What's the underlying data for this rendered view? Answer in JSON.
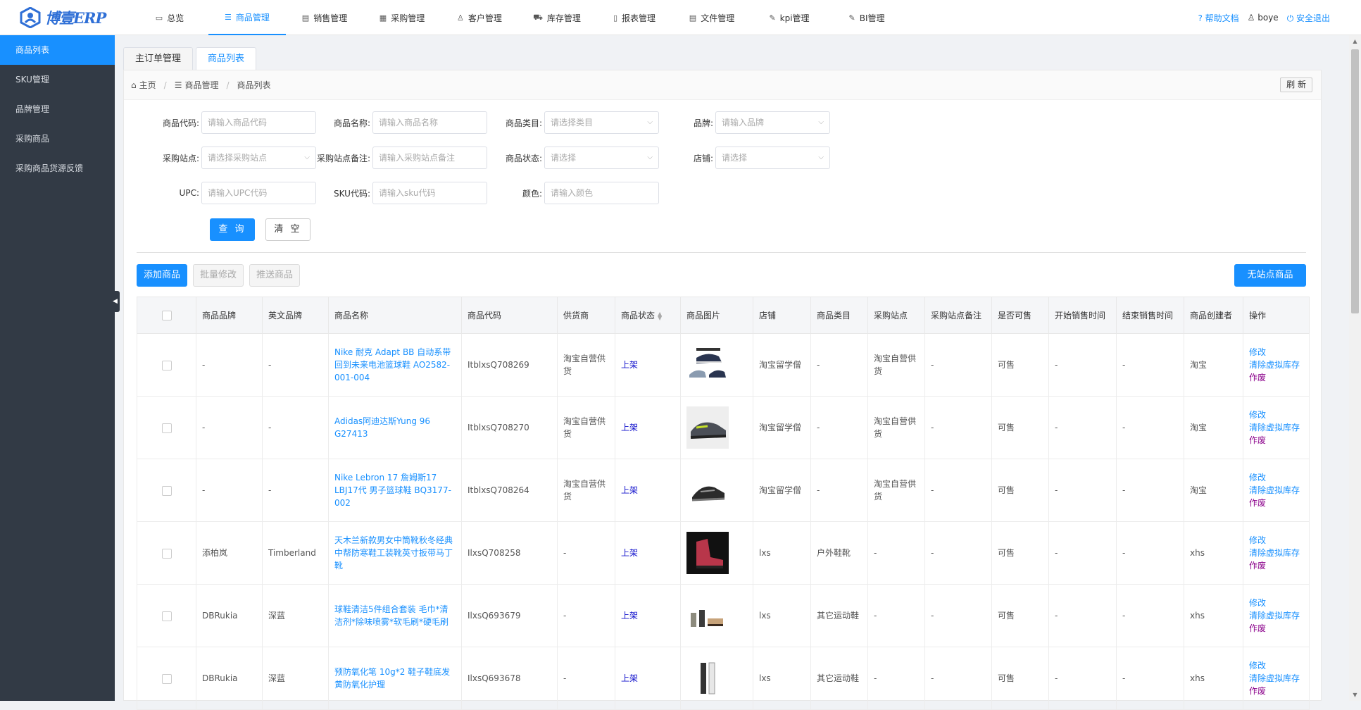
{
  "app": {
    "logo_text": "博壹ERP"
  },
  "topnav": [
    {
      "icon": "monitor-icon",
      "glyph": "▭",
      "label": "总览",
      "active": false
    },
    {
      "icon": "list-icon",
      "glyph": "☰",
      "label": "商品管理",
      "active": true
    },
    {
      "icon": "document-icon",
      "glyph": "▤",
      "label": "销售管理",
      "active": false
    },
    {
      "icon": "grid-icon",
      "glyph": "▦",
      "label": "采购管理",
      "active": false
    },
    {
      "icon": "user-icon",
      "glyph": "♙",
      "label": "客户管理",
      "active": false
    },
    {
      "icon": "cart-icon",
      "glyph": "⛟",
      "label": "库存管理",
      "active": false
    },
    {
      "icon": "file-icon",
      "glyph": "▯",
      "label": "报表管理",
      "active": false
    },
    {
      "icon": "file-list-icon",
      "glyph": "▤",
      "label": "文件管理",
      "active": false
    },
    {
      "icon": "edit-icon",
      "glyph": "✎",
      "label": "kpi管理",
      "active": false
    },
    {
      "icon": "chart-icon",
      "glyph": "✎",
      "label": "BI管理",
      "active": false
    }
  ],
  "topright": {
    "help": "? 帮助文档",
    "user": "♙ boye",
    "logout": "⏻ 安全退出"
  },
  "sidebar": [
    {
      "label": "商品列表",
      "active": true
    },
    {
      "label": "SKU管理",
      "active": false
    },
    {
      "label": "品牌管理",
      "active": false
    },
    {
      "label": "采购商品",
      "active": false
    },
    {
      "label": "采购商品货源反馈",
      "active": false
    }
  ],
  "tabs": [
    {
      "label": "主订单管理",
      "active": false
    },
    {
      "label": "商品列表",
      "active": true
    }
  ],
  "breadcrumb": {
    "home": "主页",
    "section": "商品管理",
    "page": "商品列表",
    "refresh": "刷 新"
  },
  "filters": {
    "row1": [
      {
        "label": "商品代码:",
        "placeholder": "请输入商品代码",
        "select": false
      },
      {
        "label": "商品名称:",
        "placeholder": "请输入商品名称",
        "select": false
      },
      {
        "label": "商品类目:",
        "placeholder": "请选择类目",
        "select": true
      },
      {
        "label": "品牌:",
        "placeholder": "请输入品牌",
        "select": true
      }
    ],
    "row2": [
      {
        "label": "采购站点:",
        "placeholder": "请选择采购站点",
        "select": true
      },
      {
        "label": "采购站点备注:",
        "placeholder": "请输入采购站点备注",
        "select": false
      },
      {
        "label": "商品状态:",
        "placeholder": "请选择",
        "select": true
      },
      {
        "label": "店铺:",
        "placeholder": "请选择",
        "select": true
      }
    ],
    "row3": [
      {
        "label": "UPC:",
        "placeholder": "请输入UPC代码",
        "select": false
      },
      {
        "label": "SKU代码:",
        "placeholder": "请输入sku代码",
        "select": false
      },
      {
        "label": "颜色:",
        "placeholder": "请输入颜色",
        "select": false
      }
    ],
    "query": "查 询",
    "clear": "清 空"
  },
  "actions": {
    "add": "添加商品",
    "batch_edit": "批量修改",
    "push": "推送商品",
    "no_site": "无站点商品"
  },
  "columns": [
    "商品品牌",
    "英文品牌",
    "商品名称",
    "商品代码",
    "供货商",
    "商品状态",
    "商品图片",
    "店铺",
    "商品类目",
    "采购站点",
    "采购站点备注",
    "是否可售",
    "开始销售时间",
    "结束销售时间",
    "商品创建者",
    "操作"
  ],
  "rows": [
    {
      "brand": "-",
      "en_brand": "-",
      "name": "Nike 耐克 Adapt BB 自动系带回到未来电池篮球鞋 AO2582-001-004",
      "code": "ItblxsQ708269",
      "supplier": "淘宝自营供货",
      "status": "上架",
      "image": "shoe-blue-pair",
      "shop": "淘宝留学僧",
      "category": "-",
      "site": "淘宝自营供货",
      "site_note": "-",
      "sellable": "可售",
      "start": "-",
      "end": "-",
      "creator": "淘宝"
    },
    {
      "brand": "-",
      "en_brand": "-",
      "name": "Adidas阿迪达斯Yung 96 G27413",
      "code": "ItblxsQ708270",
      "supplier": "淘宝自营供货",
      "status": "上架",
      "image": "shoe-grey",
      "shop": "淘宝留学僧",
      "category": "-",
      "site": "淘宝自营供货",
      "site_note": "-",
      "sellable": "可售",
      "start": "-",
      "end": "-",
      "creator": "淘宝"
    },
    {
      "brand": "-",
      "en_brand": "-",
      "name": "Nike Lebron 17 詹姆斯17 LBJ17代 男子篮球鞋 BQ3177-002",
      "code": "ItblxsQ708264",
      "supplier": "淘宝自营供货",
      "status": "上架",
      "image": "shoe-black",
      "shop": "淘宝留学僧",
      "category": "-",
      "site": "淘宝自营供货",
      "site_note": "-",
      "sellable": "可售",
      "start": "-",
      "end": "-",
      "creator": "淘宝"
    },
    {
      "brand": "添柏岚",
      "en_brand": "Timberland",
      "name": "天木兰新款男女中筒靴秋冬经典中帮防寒鞋工装靴英寸扳带马丁靴",
      "code": "IlxsQ708258",
      "supplier": "-",
      "status": "上架",
      "image": "boot-red",
      "shop": "lxs",
      "category": "户外鞋靴",
      "site": "-",
      "site_note": "-",
      "sellable": "可售",
      "start": "-",
      "end": "-",
      "creator": "xhs"
    },
    {
      "brand": "DBRukia",
      "en_brand": "深蓝",
      "name": "球鞋清洁5件组合套装 毛巾*清洁剂*除味喷雾*软毛刷*硬毛刷",
      "code": "IlxsQ693679",
      "supplier": "-",
      "status": "上架",
      "image": "cleaning-kit",
      "shop": "lxs",
      "category": "其它运动鞋",
      "site": "-",
      "site_note": "-",
      "sellable": "可售",
      "start": "-",
      "end": "-",
      "creator": "xhs"
    },
    {
      "brand": "DBRukia",
      "en_brand": "深蓝",
      "name": "预防氧化笔 10g*2 鞋子鞋底发黄防氧化护理",
      "code": "IlxsQ693678",
      "supplier": "-",
      "status": "上架",
      "image": "pen-pair",
      "shop": "lxs",
      "category": "其它运动鞋",
      "site": "-",
      "site_note": "-",
      "sellable": "可售",
      "start": "-",
      "end": "-",
      "creator": "xhs"
    }
  ],
  "ops": {
    "edit": "修改",
    "clear_stock": "清除虚拟库存",
    "void": "作废"
  }
}
